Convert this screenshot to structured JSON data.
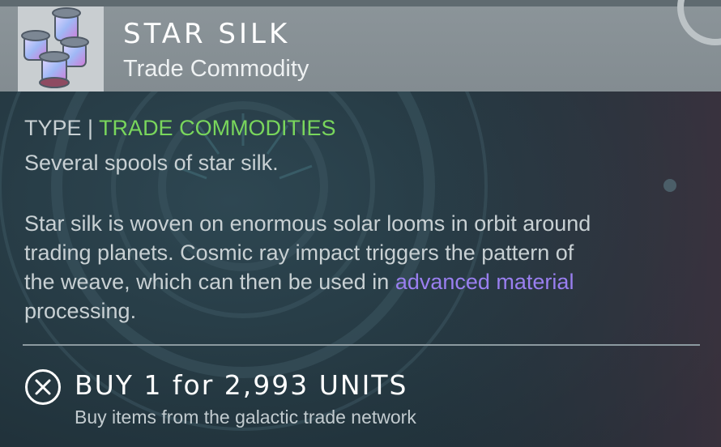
{
  "item": {
    "name": "STAR SILK",
    "category": "Trade Commodity",
    "icon": "silk-spools-icon"
  },
  "details": {
    "type_label": "TYPE |",
    "type_value": "TRADE COMMODITIES",
    "short_description": "Several spools of star silk.",
    "long_description": {
      "line1": "Star silk is woven on enormous solar looms in orbit around",
      "line2": "trading planets. Cosmic ray impact triggers the pattern of",
      "line3_prefix": "the weave, which can then be used in ",
      "line3_link": "advanced material",
      "line4": "processing."
    }
  },
  "action": {
    "icon": "close-circle-icon",
    "label": "BUY 1 for 2,993 UNITS",
    "hint": "Buy items from the galactic trade network"
  },
  "colors": {
    "type_value": "#79d65c",
    "link": "#9a7ff0",
    "header": "#878f94",
    "panel": "#24363f"
  }
}
